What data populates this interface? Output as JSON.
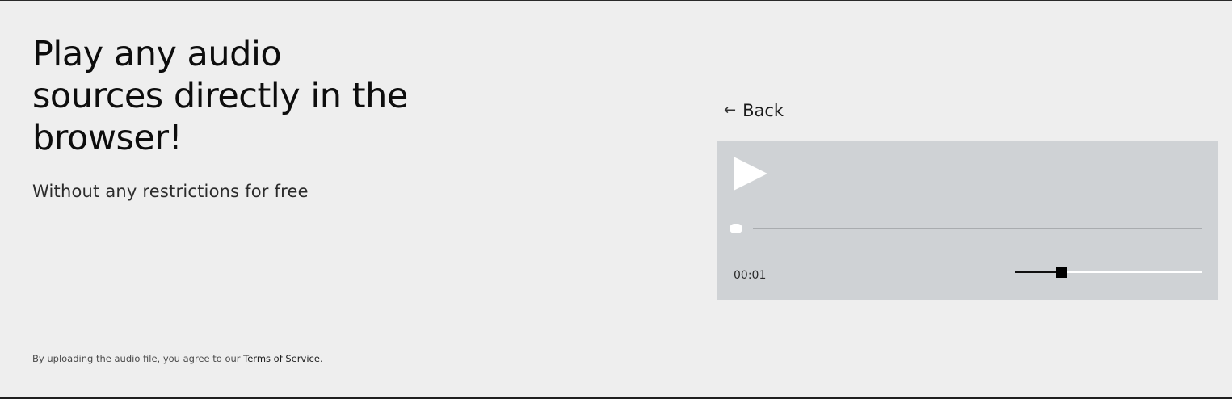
{
  "hero": {
    "title": "Play any audio sources directly in the browser!",
    "subtitle": "Without any restrictions for free"
  },
  "footer": {
    "note_prefix": "By uploading the audio file, you agree to our ",
    "terms_link": "Terms of Service",
    "note_suffix": "."
  },
  "nav": {
    "back_arrow": "←",
    "back_label": "Back"
  },
  "player": {
    "play_icon": "play-icon",
    "current_time": "00:01",
    "progress_fraction": 0.0,
    "volume_fraction": 0.25,
    "colors": {
      "panel_bg": "#cfd2d5",
      "progress_track": "#a9acaf",
      "progress_knob": "#ffffff",
      "volume_filled": "#111111",
      "volume_empty": "#ffffff",
      "volume_thumb": "#000000"
    }
  }
}
